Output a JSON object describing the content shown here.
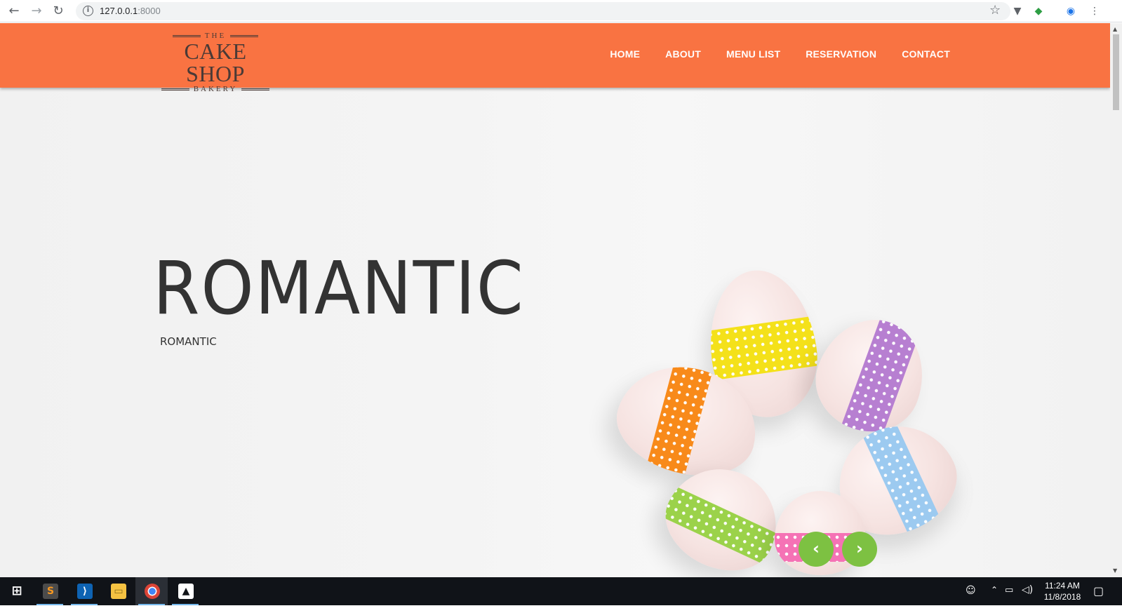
{
  "browser": {
    "url_host": "127.0.0.1",
    "url_port": ":8000"
  },
  "logo": {
    "top": "THE",
    "main": "CAKE SHOP",
    "bottom": "BAKERY"
  },
  "nav": {
    "items": [
      {
        "label": "HOME"
      },
      {
        "label": "ABOUT"
      },
      {
        "label": "MENU LIST"
      },
      {
        "label": "RESERVATION"
      },
      {
        "label": "CONTACT"
      }
    ]
  },
  "hero": {
    "title": "ROMANTIC",
    "subtitle": "ROMANTIC",
    "prev_glyph": "‹",
    "next_glyph": "›"
  },
  "taskbar": {
    "time": "11:24 AM",
    "date": "11/8/2018",
    "apps": [
      "sublime-text",
      "vscode",
      "file-explorer",
      "chrome",
      "photos"
    ]
  },
  "colors": {
    "header": "#f97342",
    "slider_button": "#7dc142"
  }
}
